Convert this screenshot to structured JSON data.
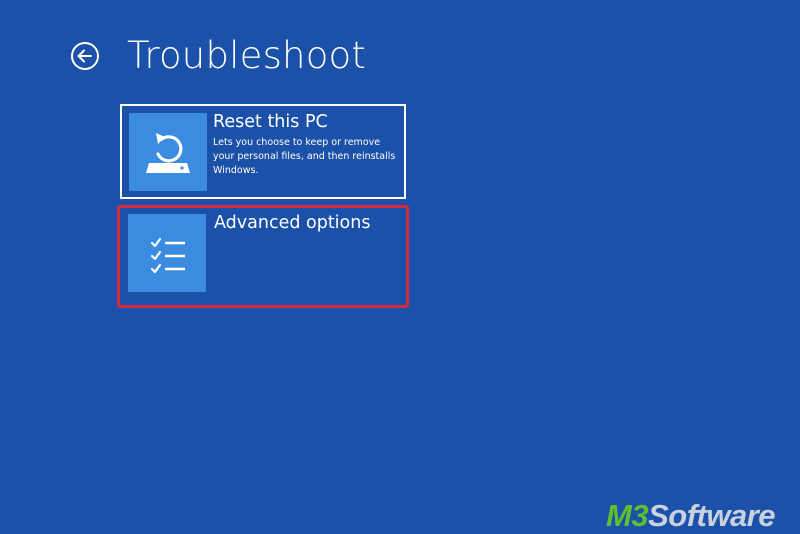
{
  "header": {
    "title": "Troubleshoot",
    "back_icon": "arrow-left-circle-icon"
  },
  "options": [
    {
      "title": "Reset this PC",
      "description": "Lets you choose to keep or remove your personal files, and then reinstalls Windows.",
      "icon": "reset-pc-icon",
      "highlighted": false
    },
    {
      "title": "Advanced options",
      "description": "",
      "icon": "checklist-icon",
      "highlighted": true
    }
  ],
  "watermark": {
    "brand": "M3",
    "text": "Software"
  },
  "colors": {
    "background": "#1b51a8",
    "tile_icon_bg": "#3b8be0",
    "highlight_border": "#d6283e",
    "watermark_brand": "#5fbf2e"
  }
}
